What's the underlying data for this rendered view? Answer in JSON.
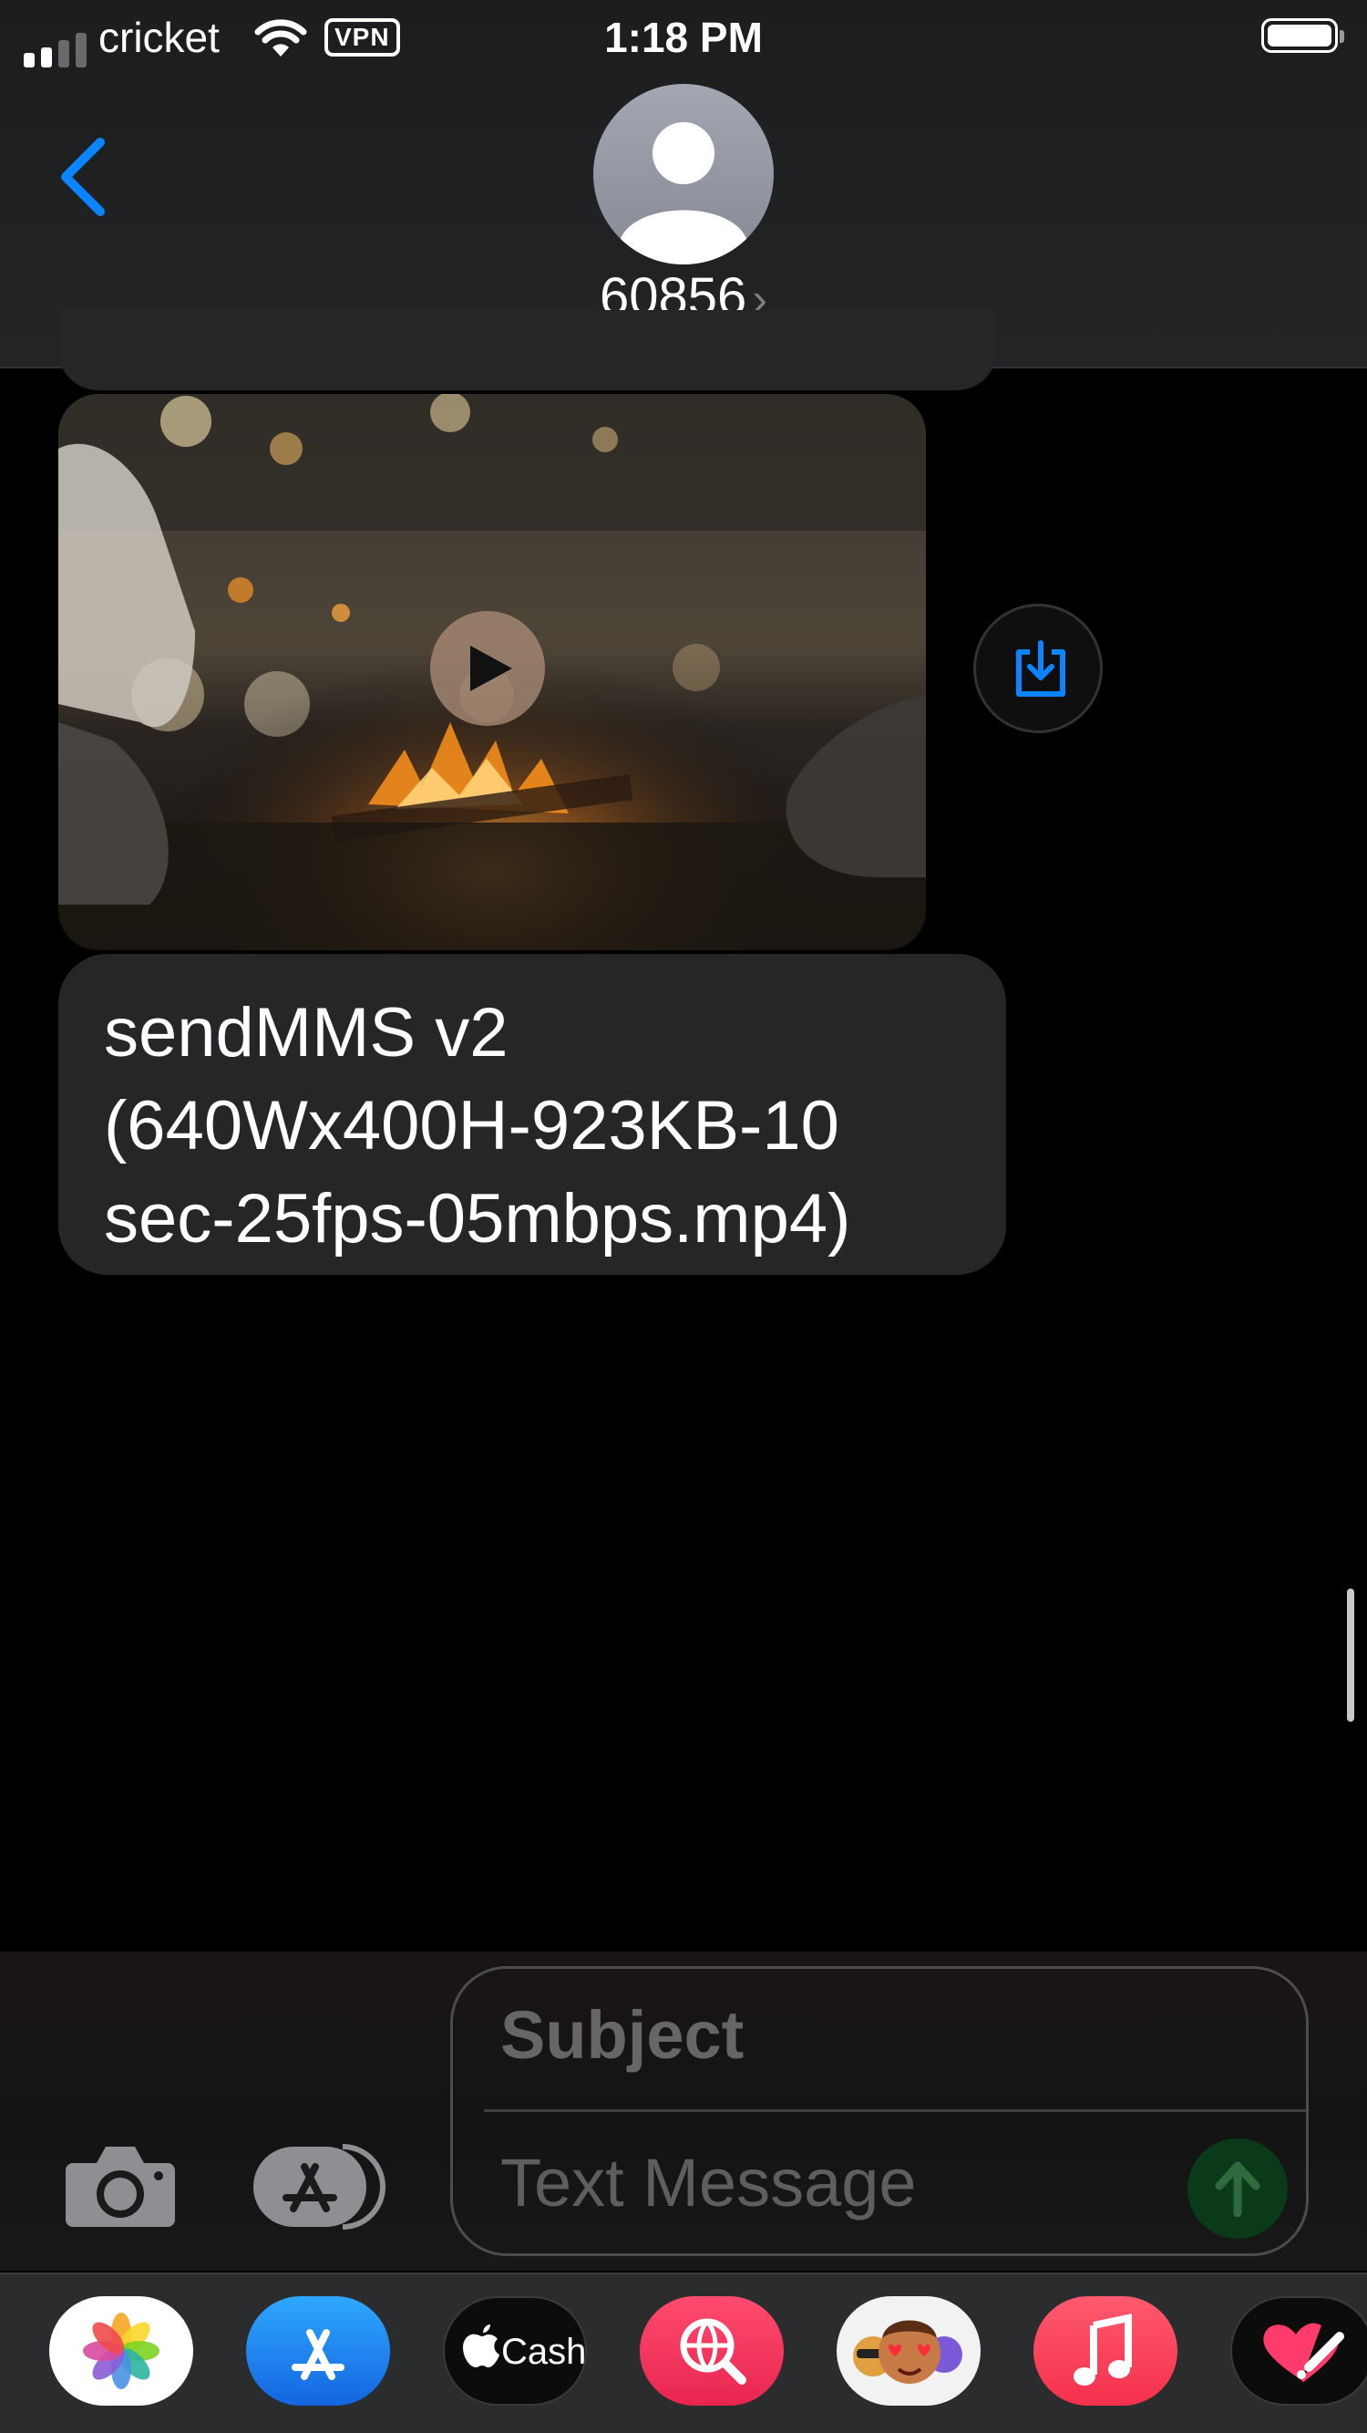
{
  "status_bar": {
    "carrier": "cricket",
    "vpn_label": "VPN",
    "time": "1:18 PM"
  },
  "header": {
    "contact_name": "60856",
    "chevron": "›",
    "back_icon": "chevron-left-icon",
    "avatar_icon": "person-avatar-icon"
  },
  "conversation": {
    "video_message": {
      "play_icon": "play-icon",
      "save_icon": "save-download-icon"
    },
    "text_message": {
      "lines": [
        "sendMMS v2",
        "(640Wx400H-923KB-10",
        "sec-25fps-05mbps.mp4)"
      ]
    }
  },
  "compose": {
    "subject_placeholder": "Subject",
    "message_placeholder": "Text Message",
    "camera_icon": "camera-icon",
    "apps_icon": "app-store-icon",
    "send_icon": "send-arrow-icon"
  },
  "app_drawer": {
    "apps": [
      {
        "name": "Photos",
        "icon": "photos-icon"
      },
      {
        "name": "App Store",
        "icon": "app-store-icon"
      },
      {
        "name": "Apple Cash",
        "icon": "apple-cash-icon",
        "label": "Cash"
      },
      {
        "name": "Images Search",
        "icon": "globe-search-icon"
      },
      {
        "name": "Memoji",
        "icon": "memoji-icon"
      },
      {
        "name": "Music",
        "icon": "music-note-icon"
      },
      {
        "name": "Digital Touch",
        "icon": "heart-touch-icon"
      }
    ]
  },
  "colors": {
    "accent_blue": "#0a84ff",
    "bubble_gray": "#262628",
    "background": "#000000",
    "send_green": "#0b3a1a"
  }
}
